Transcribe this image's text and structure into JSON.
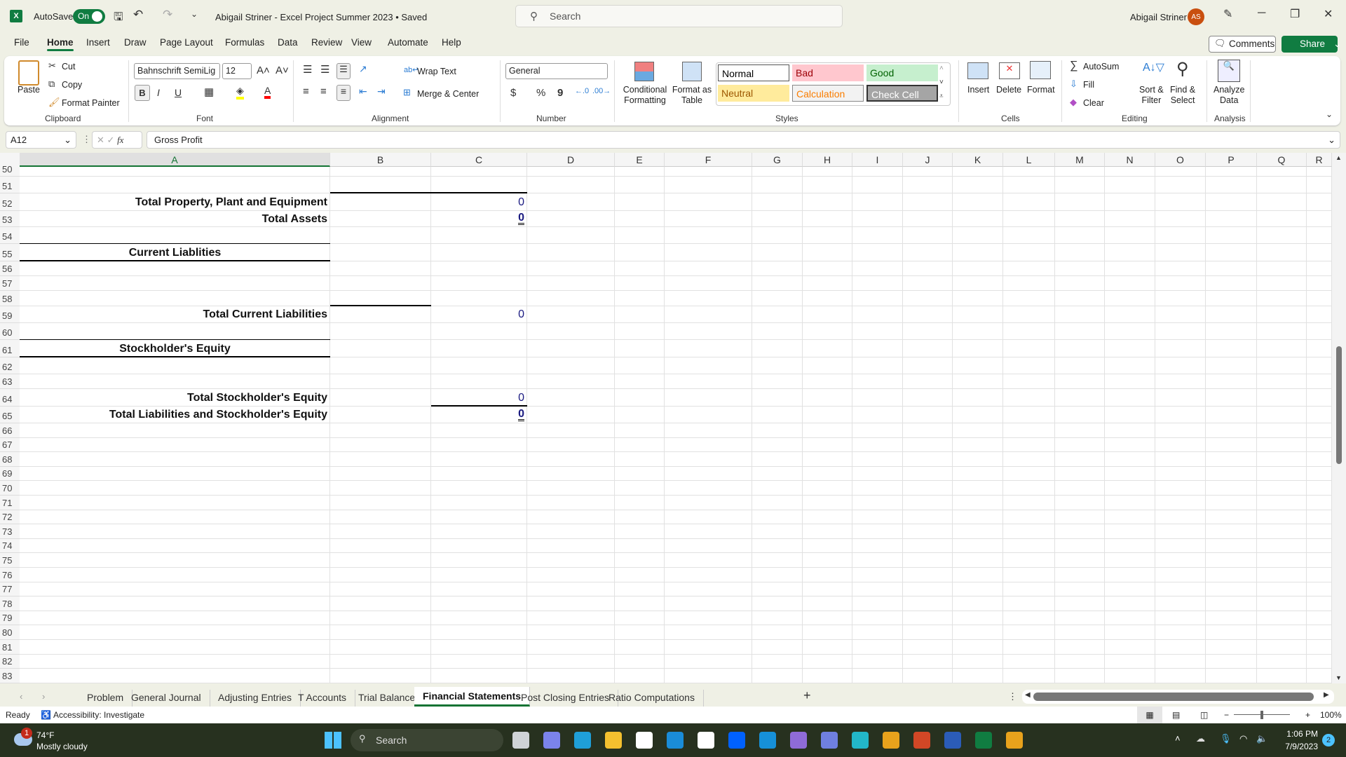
{
  "title_bar": {
    "autosave_label": "AutoSave",
    "autosave_state": "On",
    "doc_title": "Abigail Striner - Excel Project Summer 2023 • Saved",
    "search_placeholder": "Search",
    "user_name": "Abigail Striner",
    "user_initials": "AS"
  },
  "menu_tabs": [
    "File",
    "Home",
    "Insert",
    "Draw",
    "Page Layout",
    "Formulas",
    "Data",
    "Review",
    "View",
    "Automate",
    "Help"
  ],
  "active_menu_tab": "Home",
  "top_buttons": {
    "comments": "Comments",
    "share": "Share"
  },
  "ribbon": {
    "clipboard": {
      "label": "Clipboard",
      "paste": "Paste",
      "cut": "Cut",
      "copy": "Copy",
      "format_painter": "Format Painter"
    },
    "font": {
      "label": "Font",
      "font_name": "Bahnschrift SemiLig",
      "font_size": "12",
      "bold": "B",
      "italic": "I",
      "underline": "U",
      "fill_color": "#ffff00",
      "font_color": "#ff0000"
    },
    "alignment": {
      "label": "Alignment",
      "wrap_text": "Wrap Text",
      "merge_center": "Merge & Center"
    },
    "number": {
      "label": "Number",
      "format": "General",
      "currency": "$",
      "percent": "%",
      "comma": "9"
    },
    "styles": {
      "label": "Styles",
      "conditional_formatting": [
        "Conditional",
        "Formatting"
      ],
      "format_as_table": [
        "Format as",
        "Table"
      ],
      "gallery": [
        {
          "name": "Normal",
          "bg": "#ffffff",
          "fg": "#000000"
        },
        {
          "name": "Bad",
          "bg": "#ffc7ce",
          "fg": "#9c0006"
        },
        {
          "name": "Good",
          "bg": "#c6efce",
          "fg": "#006100"
        },
        {
          "name": "Neutral",
          "bg": "#ffeb9c",
          "fg": "#9c5700"
        },
        {
          "name": "Calculation",
          "bg": "#f2f2f2",
          "fg": "#fa7d00"
        },
        {
          "name": "Check Cell",
          "bg": "#a5a5a5",
          "fg": "#ffffff"
        }
      ]
    },
    "cells": {
      "label": "Cells",
      "insert": "Insert",
      "delete": "Delete",
      "format": "Format"
    },
    "editing": {
      "label": "Editing",
      "autosum": "AutoSum",
      "fill": "Fill",
      "clear": "Clear",
      "sort_filter": [
        "Sort &",
        "Filter"
      ],
      "find_select": [
        "Find &",
        "Select"
      ]
    },
    "analysis": {
      "label": "Analysis",
      "analyze_data": [
        "Analyze",
        "Data"
      ]
    }
  },
  "formula_bar": {
    "name_box": "A12",
    "fx": "fx",
    "formula": "Gross Profit"
  },
  "columns": [
    "A",
    "B",
    "C",
    "D",
    "E",
    "F",
    "G",
    "H",
    "I",
    "J",
    "K",
    "L",
    "M",
    "N",
    "O",
    "P",
    "Q",
    "R"
  ],
  "selected_column": "A",
  "rows": [
    "50",
    "51",
    "52",
    "53",
    "54",
    "55",
    "56",
    "57",
    "58",
    "59",
    "60",
    "61",
    "62",
    "63",
    "64",
    "65",
    "66",
    "67",
    "68",
    "69",
    "70",
    "71",
    "72",
    "73",
    "74",
    "75",
    "76",
    "77",
    "78",
    "79",
    "80",
    "81",
    "82",
    "83"
  ],
  "cells": [
    {
      "row": "52",
      "col": "A",
      "value": "Total Property, Plant and Equipment",
      "align": "right"
    },
    {
      "row": "52",
      "col": "C",
      "value": "0",
      "align": "right"
    },
    {
      "row": "53",
      "col": "A",
      "value": "Total Assets",
      "align": "right"
    },
    {
      "row": "53",
      "col": "C",
      "value": "0",
      "align": "right",
      "double_underline": true
    },
    {
      "row": "55",
      "col": "A",
      "value": "Current Liablities",
      "align": "center"
    },
    {
      "row": "59",
      "col": "A",
      "value": "Total Current Liabilities",
      "align": "right"
    },
    {
      "row": "59",
      "col": "C",
      "value": "0",
      "align": "right"
    },
    {
      "row": "61",
      "col": "A",
      "value": "Stockholder's Equity",
      "align": "center"
    },
    {
      "row": "64",
      "col": "A",
      "value": "Total Stockholder's Equity",
      "align": "right"
    },
    {
      "row": "64",
      "col": "C",
      "value": "0",
      "align": "right"
    },
    {
      "row": "65",
      "col": "A",
      "value": "Total Liabilities and Stockholder's Equity",
      "align": "right"
    },
    {
      "row": "65",
      "col": "C",
      "value": "0",
      "align": "right",
      "double_underline": true
    }
  ],
  "sheet_tabs": [
    "Problem",
    "General Journal",
    "Adjusting Entries",
    "T Accounts",
    "Trial Balance",
    "Financial Statements",
    "Post Closing Entries",
    "Ratio Computations"
  ],
  "active_sheet": "Financial Statements",
  "status_bar": {
    "ready": "Ready",
    "accessibility": "Accessibility: Investigate",
    "zoom": "100%",
    "zoom_level": 100
  },
  "taskbar": {
    "weather_temp": "74°F",
    "weather_desc": "Mostly cloudy",
    "weather_badge": "1",
    "search": "Search",
    "time": "1:06 PM",
    "date": "7/9/2023",
    "notifications": "2",
    "apps": [
      {
        "name": "task-view",
        "color": "#cfd3d6"
      },
      {
        "name": "teams",
        "color": "#7b83eb"
      },
      {
        "name": "edge",
        "color": "#1f9fd8"
      },
      {
        "name": "file-explorer",
        "color": "#f4c02f"
      },
      {
        "name": "microsoft-store",
        "color": "#ffffff"
      },
      {
        "name": "mail",
        "color": "#1a8cd8"
      },
      {
        "name": "amazon",
        "color": "#ffffff"
      },
      {
        "name": "dropbox",
        "color": "#0061fe"
      },
      {
        "name": "mybp",
        "color": "#1690d8"
      },
      {
        "name": "copilot",
        "color": "#8f6bd8"
      },
      {
        "name": "copilot-2",
        "color": "#6f7fe0"
      },
      {
        "name": "app-teal",
        "color": "#22b6c8"
      },
      {
        "name": "chrome",
        "color": "#e8a21c"
      },
      {
        "name": "powerpoint",
        "color": "#d24726"
      },
      {
        "name": "word",
        "color": "#2b5cb8"
      },
      {
        "name": "excel",
        "color": "#107c41"
      },
      {
        "name": "chrome-2",
        "color": "#e8a21c"
      }
    ]
  }
}
